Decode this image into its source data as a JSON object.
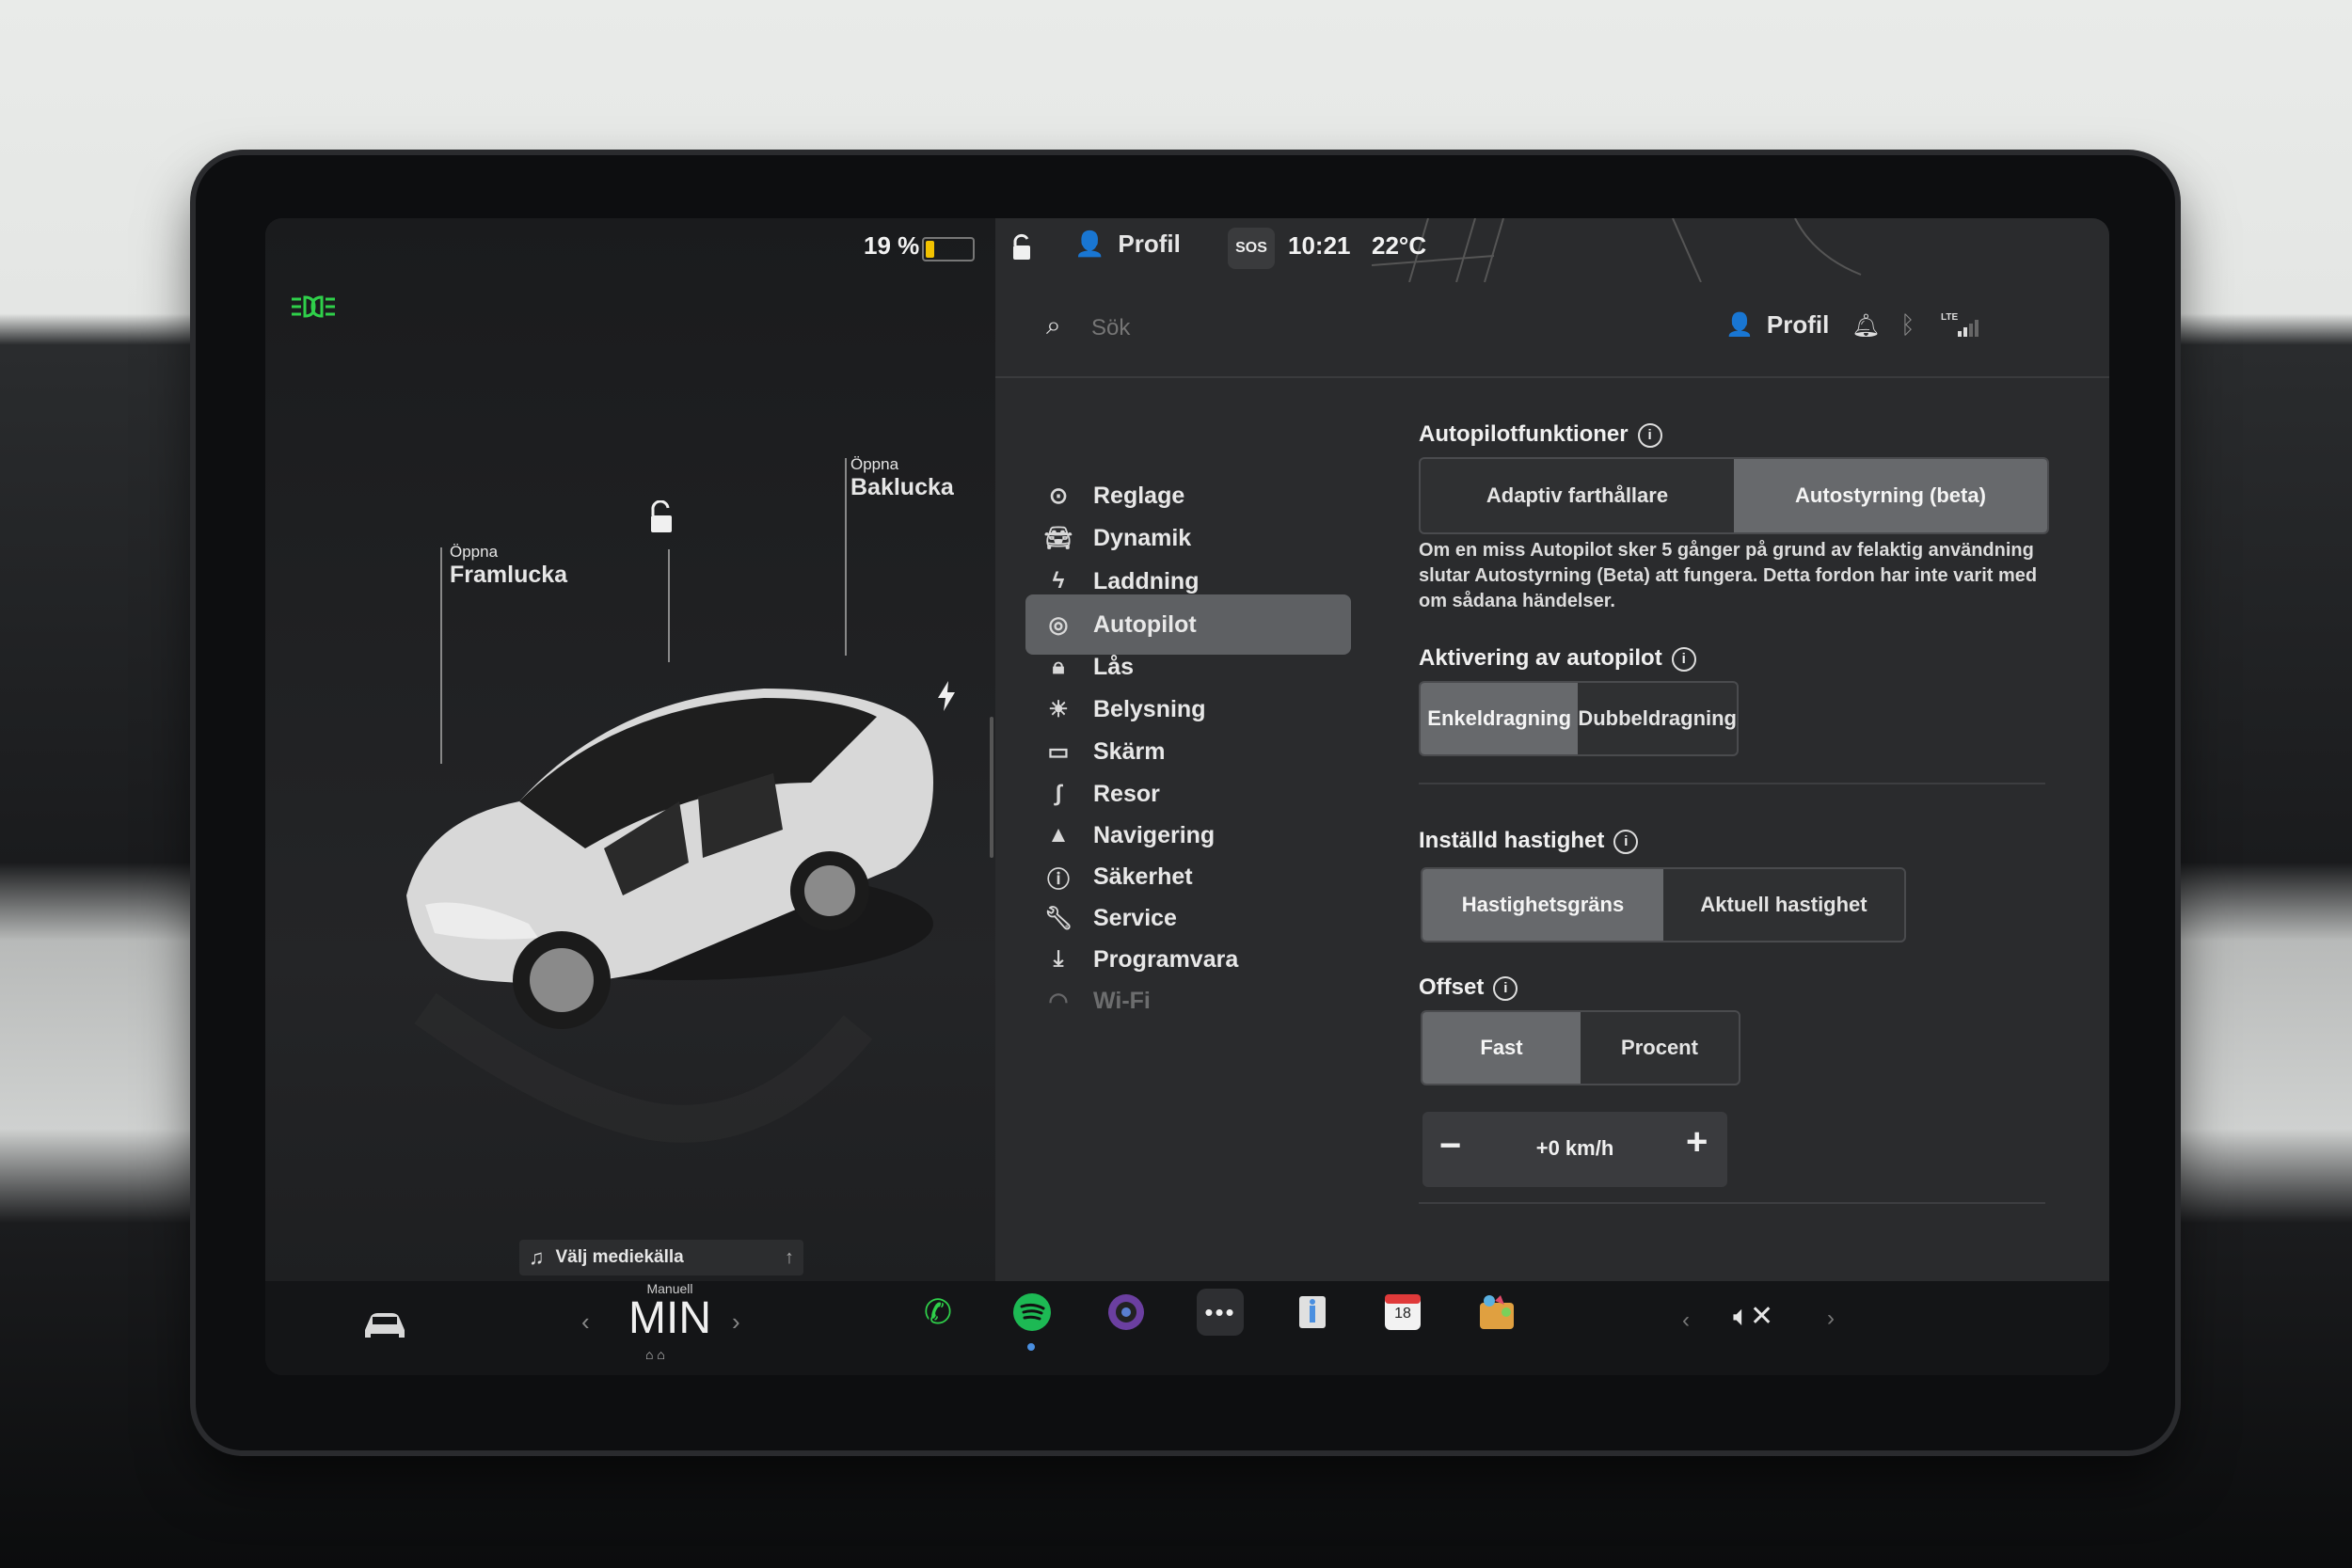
{
  "topbar": {
    "battery_percent": "19 %",
    "battery_level": 0.19,
    "profile": "Profil",
    "sos": "SOS",
    "time": "10:21",
    "temperature": "22°C"
  },
  "car_panel": {
    "front_trunk_action": "Öppna",
    "front_trunk_label": "Framlucka",
    "rear_trunk_action": "Öppna",
    "rear_trunk_label": "Baklucka",
    "media_source": "Välj mediekälla"
  },
  "search": {
    "placeholder": "Sök",
    "profile": "Profil"
  },
  "menu": {
    "items": [
      {
        "label": "Reglage",
        "icon": "toggle-icon"
      },
      {
        "label": "Dynamik",
        "icon": "car-icon"
      },
      {
        "label": "Laddning",
        "icon": "bolt-icon"
      },
      {
        "label": "Autopilot",
        "icon": "steering-wheel-icon"
      },
      {
        "label": "Lås",
        "icon": "lock-icon"
      },
      {
        "label": "Belysning",
        "icon": "sun-icon"
      },
      {
        "label": "Skärm",
        "icon": "display-icon"
      },
      {
        "label": "Resor",
        "icon": "trips-icon"
      },
      {
        "label": "Navigering",
        "icon": "navigation-icon"
      },
      {
        "label": "Säkerhet",
        "icon": "alert-icon"
      },
      {
        "label": "Service",
        "icon": "wrench-icon"
      },
      {
        "label": "Programvara",
        "icon": "download-icon"
      },
      {
        "label": "Wi-Fi",
        "icon": "wifi-icon"
      }
    ],
    "active": "Autopilot"
  },
  "autopilot": {
    "features_title": "Autopilotfunktioner",
    "features_options": [
      "Adaptiv farthållare",
      "Autostyrning (beta)"
    ],
    "features_selected": "Autostyrning (beta)",
    "description": "Om en miss Autopilot sker 5 gånger på grund av felaktig användning slutar Autostyrning (Beta) att fungera. Detta fordon har inte varit med om sådana händelser.",
    "activation_title": "Aktivering av autopilot",
    "activation_options": [
      "Enkeldragning",
      "Dubbeldragning"
    ],
    "activation_selected": "Enkeldragning",
    "set_speed_title": "Inställd hastighet",
    "set_speed_options": [
      "Hastighetsgräns",
      "Aktuell hastighet"
    ],
    "set_speed_selected": "Hastighetsgräns",
    "offset_title": "Offset",
    "offset_options": [
      "Fast",
      "Procent"
    ],
    "offset_selected": "Fast",
    "offset_value": "+0 km/h",
    "minus": "−",
    "plus": "+"
  },
  "bottom": {
    "climate_mode": "Manuell",
    "climate_value": "MIN",
    "calendar_day": "18"
  },
  "colors": {
    "accent_green": "#2fd04a",
    "spotify_green": "#1db954",
    "battery_yellow": "#f2c200"
  }
}
